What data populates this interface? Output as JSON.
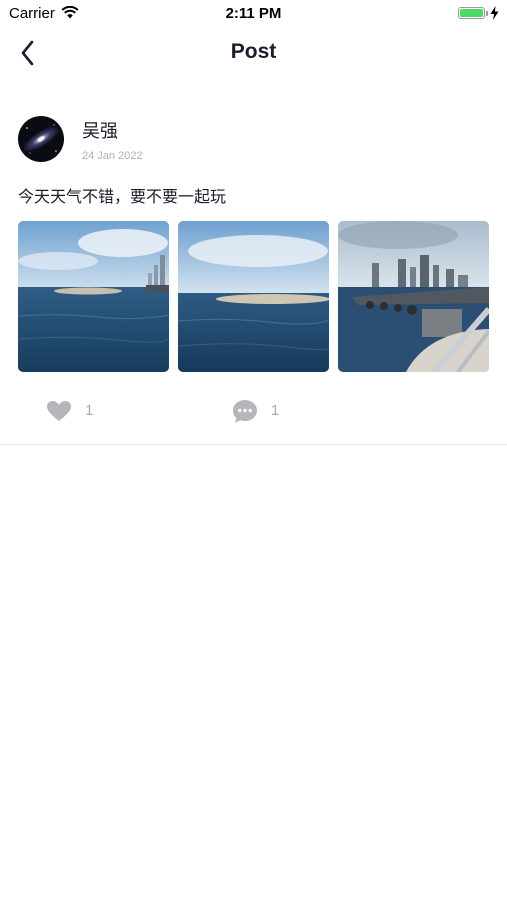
{
  "status_bar": {
    "carrier": "Carrier",
    "time": "2:11 PM",
    "battery_level": 1.0,
    "battery_color": "#4cd964"
  },
  "nav": {
    "title": "Post",
    "back_icon": "chevron-left-icon"
  },
  "post": {
    "author": "吴强",
    "date": "24 Jan 2022",
    "text": "今天天气不错，要不要一起玩",
    "photos": [
      {
        "subject": "sea-breakwater-city"
      },
      {
        "subject": "sea-breakwater"
      },
      {
        "subject": "pier-city-skyline"
      }
    ],
    "likes": "1",
    "comments": "1",
    "like_icon": "heart-icon",
    "comment_icon": "comment-bubble-icon"
  },
  "colors": {
    "text": "#1c1c2e",
    "muted": "#a8a8b0",
    "icon": "#b5b5bb"
  }
}
